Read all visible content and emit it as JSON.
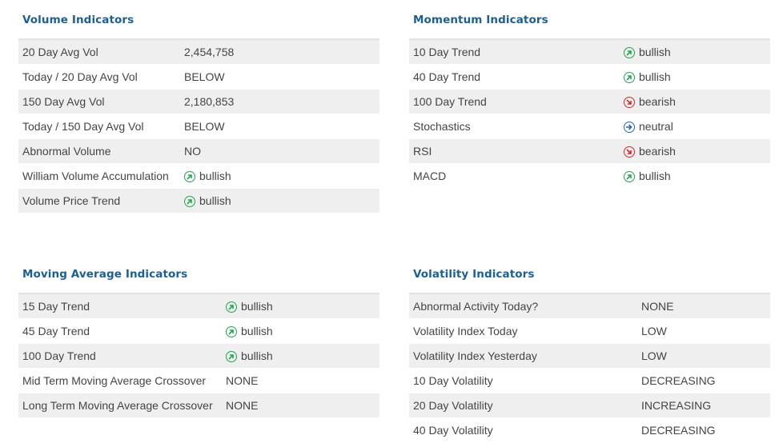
{
  "volume": {
    "title": "Volume Indicators",
    "rows": [
      {
        "label": "20 Day Avg Vol",
        "value": "2,454,758",
        "icon": ""
      },
      {
        "label": "Today / 20 Day Avg Vol",
        "value": "BELOW",
        "icon": ""
      },
      {
        "label": "150 Day Avg Vol",
        "value": "2,180,853",
        "icon": ""
      },
      {
        "label": "Today / 150 Day Avg Vol",
        "value": "BELOW",
        "icon": ""
      },
      {
        "label": "Abnormal Volume",
        "value": "NO",
        "icon": ""
      },
      {
        "label": "William Volume Accumulation",
        "value": "bullish",
        "icon": "bullish-icon"
      },
      {
        "label": "Volume Price Trend",
        "value": "bullish",
        "icon": "bullish-icon"
      }
    ]
  },
  "momentum": {
    "title": "Momentum Indicators",
    "rows": [
      {
        "label": "10 Day Trend",
        "value": "bullish",
        "icon": "bullish-icon"
      },
      {
        "label": "40 Day Trend",
        "value": "bullish",
        "icon": "bullish-icon"
      },
      {
        "label": "100 Day Trend",
        "value": "bearish",
        "icon": "bearish-icon"
      },
      {
        "label": "Stochastics",
        "value": "neutral",
        "icon": "neutral-icon"
      },
      {
        "label": "RSI",
        "value": "bearish",
        "icon": "bearish-icon"
      },
      {
        "label": "MACD",
        "value": "bullish",
        "icon": "bullish-icon"
      }
    ]
  },
  "moving_average": {
    "title": "Moving Average Indicators",
    "rows": [
      {
        "label": "15 Day Trend",
        "value": "bullish",
        "icon": "bullish-icon"
      },
      {
        "label": "45 Day Trend",
        "value": "bullish",
        "icon": "bullish-icon"
      },
      {
        "label": "100 Day Trend",
        "value": "bullish",
        "icon": "bullish-icon"
      },
      {
        "label": "Mid Term Moving Average Crossover",
        "value": "NONE",
        "icon": ""
      },
      {
        "label": "Long Term Moving Average Crossover",
        "value": "NONE",
        "icon": ""
      }
    ]
  },
  "volatility": {
    "title": "Volatility Indicators",
    "rows": [
      {
        "label": "Abnormal Activity Today?",
        "value": "NONE",
        "icon": ""
      },
      {
        "label": "Volatility Index Today",
        "value": "LOW",
        "icon": ""
      },
      {
        "label": "Volatility Index Yesterday",
        "value": "LOW",
        "icon": ""
      },
      {
        "label": "10 Day Volatility",
        "value": "DECREASING",
        "icon": ""
      },
      {
        "label": "20 Day Volatility",
        "value": "INCREASING",
        "icon": ""
      },
      {
        "label": "40 Day Volatility",
        "value": "DECREASING",
        "icon": ""
      }
    ]
  },
  "colors": {
    "title": "#1a5f95",
    "bullish": "#22a550",
    "bearish": "#d42a2a",
    "neutral": "#2a62b8",
    "row_alt": "#efefef"
  }
}
